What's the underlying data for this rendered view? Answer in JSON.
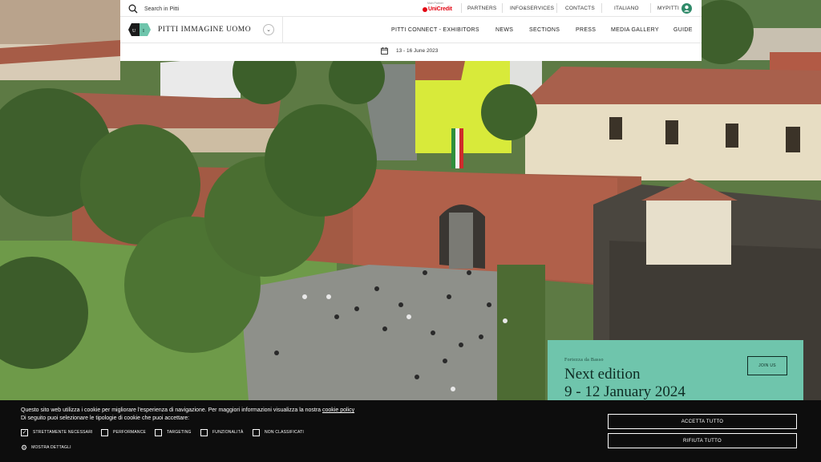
{
  "header": {
    "search_label": "Search in Pitti",
    "partner": {
      "label": "Main Partner",
      "name": "UniCredit"
    },
    "top_nav": [
      "PARTNERS",
      "INFO&SERVICES",
      "CONTACTS",
      "ITALIANO",
      "MYPITTI"
    ],
    "brand": {
      "name": "PITTI IMMAGINE UOMO",
      "toggle_glyph": "⌄"
    },
    "main_nav": [
      "PITTI CONNECT - EXHIBITORS",
      "NEWS",
      "SECTIONS",
      "PRESS",
      "MEDIA GALLERY",
      "GUIDE"
    ],
    "event_dates": "13 - 16 June 2023"
  },
  "edition_card": {
    "venue": "Fortezza da Basso",
    "title": "Next edition",
    "dates": "9 - 12 January 2024",
    "join_label": "JOIN US",
    "bg_color": "#6fc5ac"
  },
  "cookie_banner": {
    "text_before_link": "Questo sito web utilizza i cookie per migliorare l'esperienza di navigazione. Per maggiori informazioni visualizza la nostra ",
    "link_text": "cookie policy",
    "line2": "Di seguito puoi selezionare le tipologie di cookie che puoi accettare:",
    "options": [
      {
        "label": "STRETTAMENTE NECESSARI",
        "checked": true,
        "mark": "✓"
      },
      {
        "label": "PERFORMANCE",
        "checked": false,
        "mark": ""
      },
      {
        "label": "TARGETING",
        "checked": false,
        "mark": ""
      },
      {
        "label": "FUNZIONALITÀ",
        "checked": false,
        "mark": ""
      },
      {
        "label": "NON CLASSIFICATI",
        "checked": false,
        "mark": ""
      }
    ],
    "details_label": "MOSTRA DETTAGLI",
    "accept_label": "ACCETTA TUTTO",
    "reject_label": "RIFIUTA TUTTO"
  },
  "icons": {
    "search": "search-icon",
    "user": "user-icon",
    "calendar": "calendar-icon",
    "gear": "gear-icon",
    "chevron": "chevron-down-icon"
  }
}
